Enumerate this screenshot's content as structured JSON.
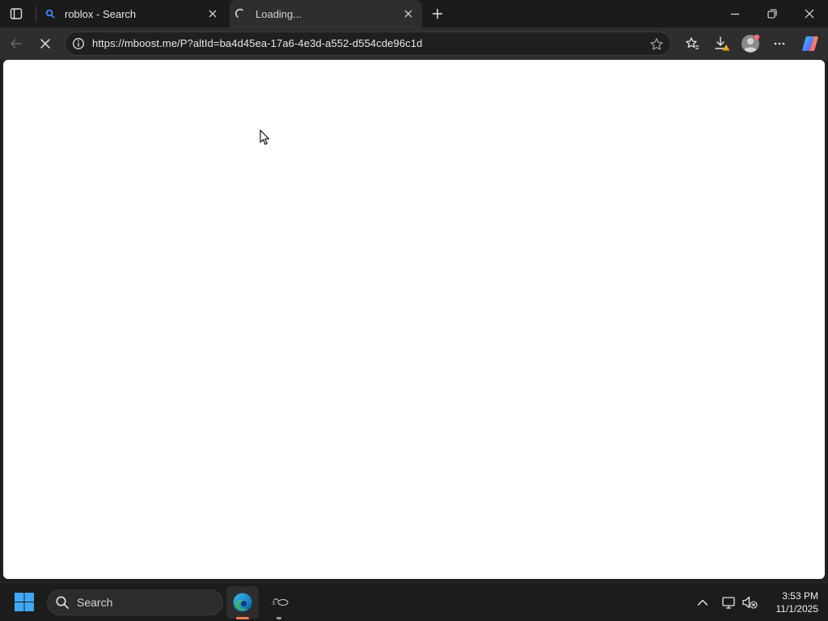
{
  "browser": {
    "tabs": [
      {
        "title": "roblox - Search",
        "icon": "search-icon"
      },
      {
        "title": "Loading...",
        "icon": "loading-spinner-icon"
      }
    ],
    "address_bar": {
      "url": "https://mboost.me/P?altId=ba4d45ea-17a6-4e3d-a552-d554cde96c1d"
    },
    "accent_colors": {
      "download_warning": "#f0a020",
      "profile_badge": "#ff6b6b",
      "edge_indicator": "#ff7a54"
    }
  },
  "taskbar": {
    "search_label": "Search",
    "clock": {
      "time": "3:53 PM",
      "date": "11/1/2025"
    }
  }
}
